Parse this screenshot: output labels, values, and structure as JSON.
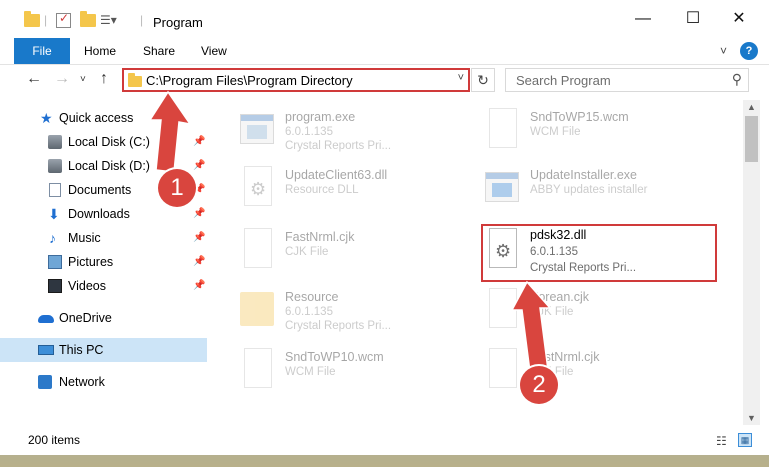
{
  "window": {
    "title": "Program"
  },
  "window_controls": {
    "minimize": "—",
    "maximize": "☐",
    "close": "✕"
  },
  "ribbon": {
    "file": "File",
    "home": "Home",
    "share": "Share",
    "view": "View",
    "help": "?"
  },
  "address_bar": {
    "path": "C:\\Program Files\\Program Directory"
  },
  "search": {
    "placeholder": "Search Program"
  },
  "sidebar": {
    "items": [
      {
        "label": "Quick access",
        "icon": "star-icon",
        "pinned": false
      },
      {
        "label": "Local Disk (C:)",
        "icon": "disk-icon",
        "pinned": true
      },
      {
        "label": "Local Disk (D:)",
        "icon": "disk-icon",
        "pinned": true
      },
      {
        "label": "Documents",
        "icon": "documents-icon",
        "pinned": true
      },
      {
        "label": "Downloads",
        "icon": "download-icon",
        "pinned": true
      },
      {
        "label": "Music",
        "icon": "music-icon",
        "pinned": true
      },
      {
        "label": "Pictures",
        "icon": "pictures-icon",
        "pinned": true
      },
      {
        "label": "Videos",
        "icon": "videos-icon",
        "pinned": true
      },
      {
        "label": "OneDrive",
        "icon": "cloud-icon",
        "pinned": false
      },
      {
        "label": "This PC",
        "icon": "computer-icon",
        "pinned": false,
        "selected": true
      },
      {
        "label": "Network",
        "icon": "network-icon",
        "pinned": false
      }
    ]
  },
  "files": [
    {
      "name": "program.exe",
      "line2": "6.0.1.135",
      "line3": "Crystal Reports Pri...",
      "icon": "exe-icon"
    },
    {
      "name": "SndToWP15.wcm",
      "line2": "WCM File",
      "line3": "",
      "icon": "file-icon"
    },
    {
      "name": "UpdateClient63.dll",
      "line2": "Resource DLL",
      "line3": "",
      "icon": "dll-icon"
    },
    {
      "name": "UpdateInstaller.exe",
      "line2": "ABBY updates installer",
      "line3": "",
      "icon": "installer-icon"
    },
    {
      "name": "FastNrml.cjk",
      "line2": "CJK File",
      "line3": "",
      "icon": "file-icon"
    },
    {
      "name": "pdsk32.dll",
      "line2": "6.0.1.135",
      "line3": "Crystal Reports Pri...",
      "icon": "dll-icon",
      "highlighted": true
    },
    {
      "name": "Resource",
      "line2": "6.0.1.135",
      "line3": "Crystal Reports Pri...",
      "icon": "folder-icon"
    },
    {
      "name": "Korean.cjk",
      "line2": "CJK File",
      "line3": "",
      "icon": "file-icon"
    },
    {
      "name": "SndToWP10.wcm",
      "line2": "WCM File",
      "line3": "",
      "icon": "file-icon"
    },
    {
      "name": "FastNrml.cjk",
      "line2": "CJK File",
      "line3": "",
      "icon": "file-icon"
    }
  ],
  "status": {
    "item_count": "200 items"
  },
  "annotations": {
    "step1": "1",
    "step2": "2",
    "color": "#d9453e"
  },
  "colors": {
    "accent": "#1979ca",
    "highlight_border": "#d03a3a",
    "selected_bg": "#cce4f7"
  }
}
